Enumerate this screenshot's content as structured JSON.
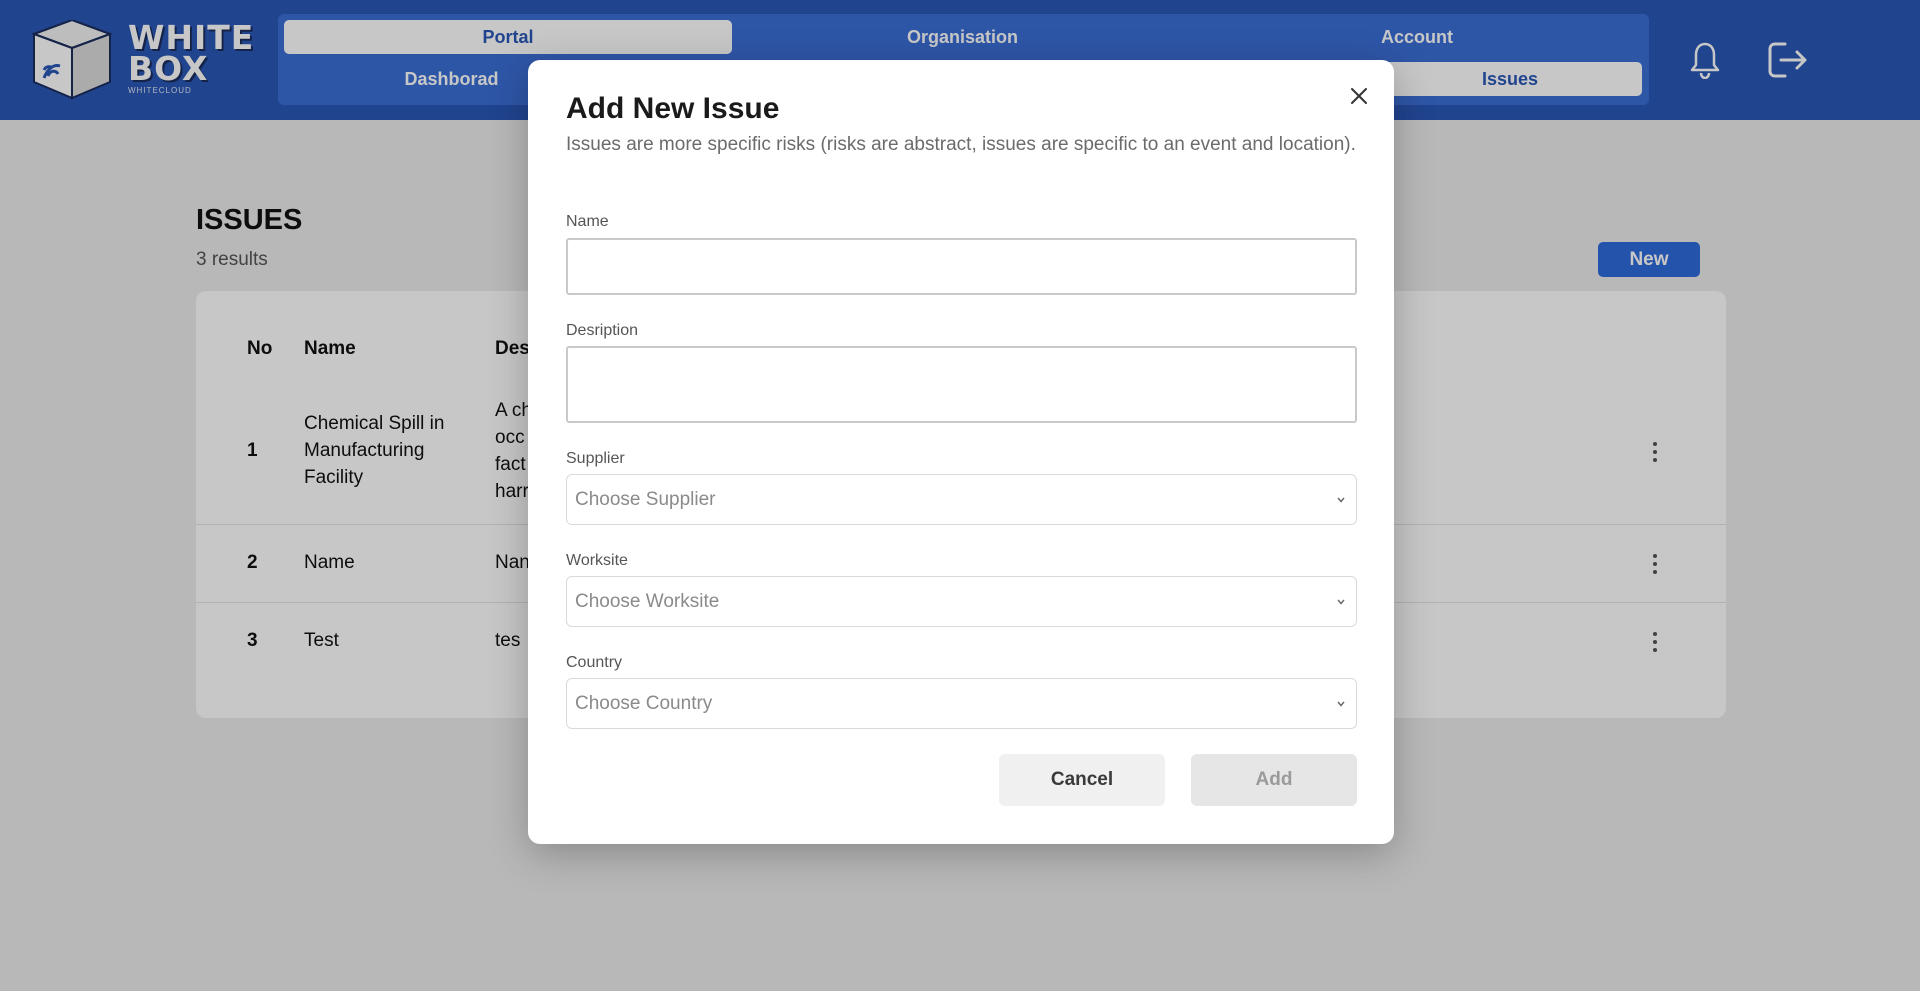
{
  "brand": {
    "line1": "WHITE",
    "line2": "BOX",
    "sub": "WHITECLOUD"
  },
  "nav": {
    "portal": "Portal",
    "organisation": "Organisation",
    "account": "Account",
    "dashboard": "Dashborad",
    "issues": "Issues"
  },
  "page": {
    "title": "ISSUES",
    "count": "3 results",
    "new_label": "New",
    "table": {
      "headers": {
        "no": "No",
        "name": "Name",
        "desc": "Des"
      },
      "rows": [
        {
          "no": "1",
          "name": "Chemical Spill in Manufacturing Facility",
          "desc": [
            "A ch",
            "occ",
            "fact",
            "harr"
          ]
        },
        {
          "no": "2",
          "name": "Name",
          "desc": [
            "Nan"
          ]
        },
        {
          "no": "3",
          "name": "Test",
          "desc": [
            "tes"
          ]
        }
      ]
    }
  },
  "modal": {
    "title": "Add New Issue",
    "description": "Issues are more specific risks (risks are abstract, issues are specific to an event and location).",
    "name_label": "Name",
    "desc_label": "Desription",
    "supplier_label": "Supplier",
    "supplier_placeholder": "Choose Supplier",
    "worksite_label": "Worksite",
    "worksite_placeholder": "Choose Worksite",
    "country_label": "Country",
    "country_placeholder": "Choose Country",
    "cancel_label": "Cancel",
    "add_label": "Add"
  },
  "icons": {
    "bell": "bell-icon",
    "logout": "logout-icon",
    "close": "close-icon",
    "more": "more-vertical-icon",
    "chevron": "chevron-down-icon"
  },
  "colors": {
    "header": "#2b58b8",
    "nav": "#3b6fd6",
    "primary": "#2f6bdc"
  }
}
